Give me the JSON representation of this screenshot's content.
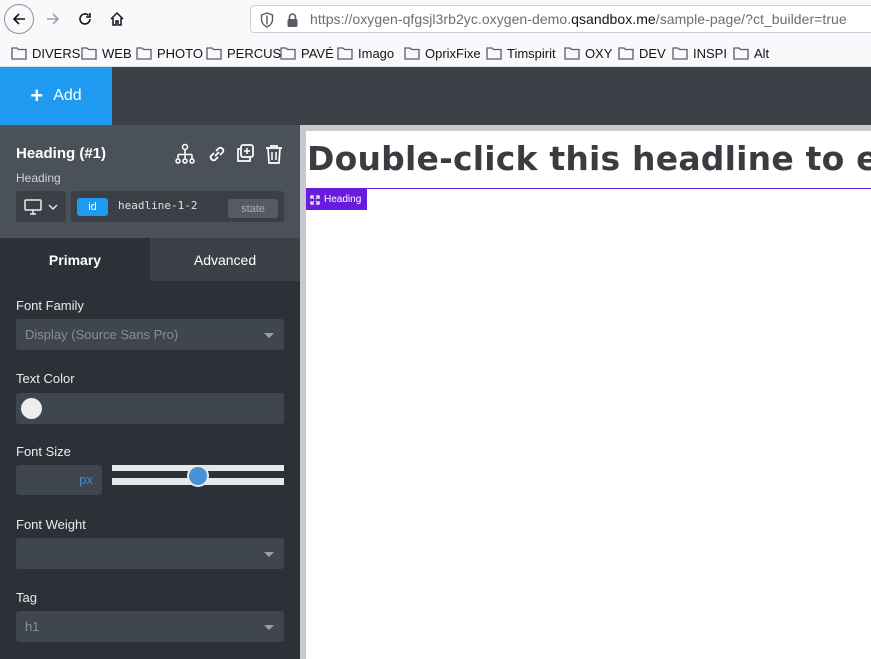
{
  "browser": {
    "url_prefix": "https://oxygen-qfgsjl3rb2yc.oxygen-demo.",
    "url_domain": "qsandbox.me",
    "url_suffix": "/sample-page/?ct_builder=true",
    "bookmarks": [
      "DIVERS",
      "WEB",
      "PHOTO",
      "PERCUS",
      "PAVÉ",
      "Imago",
      "OprixFixe",
      "Timspirit",
      "OXY",
      "DEV",
      "INSPI",
      "Alt"
    ]
  },
  "builder": {
    "add_label": "Add",
    "accent": "#1e9bf0",
    "selection_color": "#6a1be0"
  },
  "element": {
    "title": "Heading (#1)",
    "type": "Heading",
    "id_badge": "id",
    "id_value": "headline-1-2",
    "state_label": "state"
  },
  "tabs": {
    "primary": "Primary",
    "advanced": "Advanced"
  },
  "fields": {
    "font_family": {
      "label": "Font Family",
      "value": "Display (Source Sans Pro)"
    },
    "text_color": {
      "label": "Text Color",
      "swatch": "#eeeeee"
    },
    "font_size": {
      "label": "Font Size",
      "unit": "px",
      "slider_fraction": 0.5
    },
    "font_weight": {
      "label": "Font Weight",
      "value": ""
    },
    "tag": {
      "label": "Tag",
      "value": "h1"
    }
  },
  "canvas": {
    "headline": "Double-click this headline to edit the text.",
    "selection_label": "Heading"
  }
}
